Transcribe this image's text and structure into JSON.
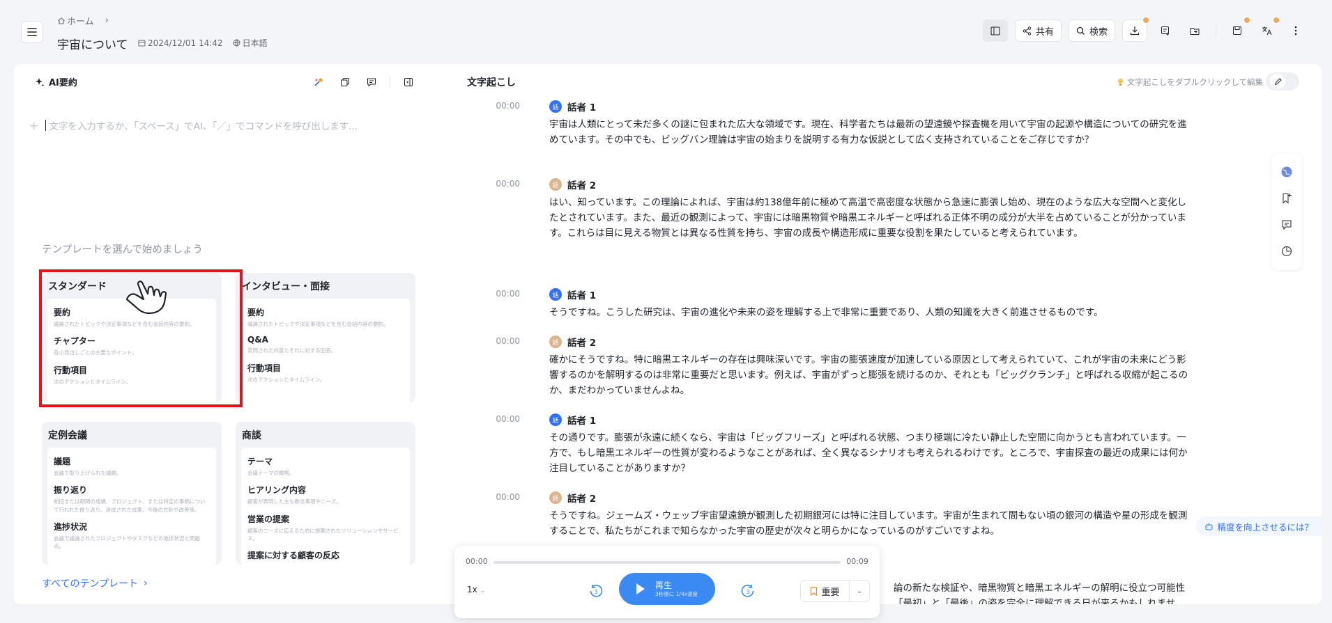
{
  "header": {
    "breadcrumb_home": "ホーム",
    "title": "宇宙について",
    "date": "2024/12/01 14:42",
    "language": "日本語",
    "share_label": "共有",
    "search_label": "検索"
  },
  "summary": {
    "title": "AI要約",
    "placeholder": "文字を入力するか、「スペース」でAI、「／」でコマンドを呼び出します...",
    "template_heading": "テンプレートを選んで始めましょう",
    "all_templates": "すべてのテンプレート",
    "templates": [
      {
        "title": "スタンダード",
        "items": [
          {
            "title": "要約",
            "desc": "議論されたトピックや決定事項などを含む会話内容の要約。"
          },
          {
            "title": "チャプター",
            "desc": "各小見出しごとの主要なポイント。"
          },
          {
            "title": "行動項目",
            "desc": "次のアクションとタイムライン。"
          }
        ]
      },
      {
        "title": "インタビュー・面接",
        "items": [
          {
            "title": "要約",
            "desc": "議論されたトピックや決定事項などを含む会話内容の要約。"
          },
          {
            "title": "Q&A",
            "desc": "質問された内容とそれに対する回答。"
          },
          {
            "title": "行動項目",
            "desc": "次のアクションとタイムライン。"
          }
        ]
      },
      {
        "title": "定例会議",
        "items": [
          {
            "title": "議題",
            "desc": "会議で取り上げられた議題。"
          },
          {
            "title": "振り返り",
            "desc": "前回または期間の成績、プロジェクト、または特定の事柄について行われた振り返り。達成された成果、今後の方針や改善策。"
          },
          {
            "title": "進捗状況",
            "desc": "会議で議論されたプロジェクトやタスクなどの進捗状況と問題点。"
          }
        ]
      },
      {
        "title": "商談",
        "items": [
          {
            "title": "テーマ",
            "desc": "会議テーマの概略。"
          },
          {
            "title": "ヒアリング内容",
            "desc": "顧客が表明した主な懸念事項やニーズ。"
          },
          {
            "title": "営業の提案",
            "desc": "顧客のニーズに応えるために提案されたソリューションやサービス。"
          },
          {
            "title": "提案に対する顧客の反応",
            "desc": ""
          }
        ]
      }
    ]
  },
  "transcript": {
    "title": "文字起こし",
    "hint": "文字起こしをダブルクリックして編集",
    "segments": [
      {
        "time": "00:00",
        "speaker": "話者 1",
        "avatar": "s1",
        "text": "宇宙は人類にとって未だ多くの謎に包まれた広大な領域です。現在、科学者たちは最新の望遠鏡や探査機を用いて宇宙の起源や構造についての研究を進めています。その中でも、ビッグバン理論は宇宙の始まりを説明する有力な仮説として広く支持されていることをご存じですか？"
      },
      {
        "time": "00:00",
        "speaker": "話者 2",
        "avatar": "s2",
        "text": "はい、知っています。この理論によれば、宇宙は約138億年前に極めて高温で高密度な状態から急速に膨張し始め、現在のような広大な空間へと変化したとされています。また、最近の観測によって、宇宙には暗黒物質や暗黒エネルギーと呼ばれる正体不明の成分が大半を占めていることが分かっています。これらは目に見える物質とは異なる性質を持ち、宇宙の成長や構造形成に重要な役割を果たしていると考えられています。"
      },
      {
        "time": "00:00",
        "speaker": "話者 1",
        "avatar": "s1",
        "text": "そうですね。こうした研究は、宇宙の進化や未来の姿を理解する上で非常に重要であり、人類の知識を大きく前進させるものです。"
      },
      {
        "time": "00:00",
        "speaker": "話者 2",
        "avatar": "s2",
        "text": "確かにそうですね。特に暗黒エネルギーの存在は興味深いです。宇宙の膨張速度が加速している原因として考えられていて、これが宇宙の未来にどう影響するのかを解明するのは非常に重要だと思います。例えば、宇宙がずっと膨張を続けるのか、それとも「ビッグクランチ」と呼ばれる収縮が起こるのか、まだわかっていませんよね。"
      },
      {
        "time": "00:00",
        "speaker": "話者 1",
        "avatar": "s1",
        "text": "その通りです。膨張が永遠に続くなら、宇宙は「ビッグフリーズ」と呼ばれる状態、つまり極端に冷たい静止した空間に向かうとも言われています。一方で、もし暗黒エネルギーの性質が変わるようなことがあれば、全く異なるシナリオも考えられるわけです。ところで、宇宙探査の最近の成果には何か注目していることがありますか？"
      },
      {
        "time": "00:00",
        "speaker": "話者 2",
        "avatar": "s2",
        "text": "そうですね。ジェームズ・ウェッブ宇宙望遠鏡が観測した初期銀河には特に注目しています。宇宙が生まれて間もない頃の銀河の構造や星の形成を観測することで、私たちがこれまで知らなかった宇宙の歴史が次々と明らかになっているのがすごいですよね。"
      }
    ],
    "partial_line1": "論の新たな検証や、暗黒物質と暗黒エネルギーの解明に役立つ可能性",
    "partial_line2": "「最初」と「最後」の姿を完全に理解できる日が来るかもしれませ"
  },
  "accuracy_label": "精度を向上させるには？",
  "player": {
    "current": "00:00",
    "total": "00:09",
    "progress": 0.0,
    "speed": "1x",
    "play_label": "再生",
    "play_sub": "3秒後に 1/4x速度",
    "important_label": "重要",
    "skip_seconds": "3"
  },
  "colors": {
    "accent": "#3b8af4",
    "highlight": "#e8111a"
  }
}
